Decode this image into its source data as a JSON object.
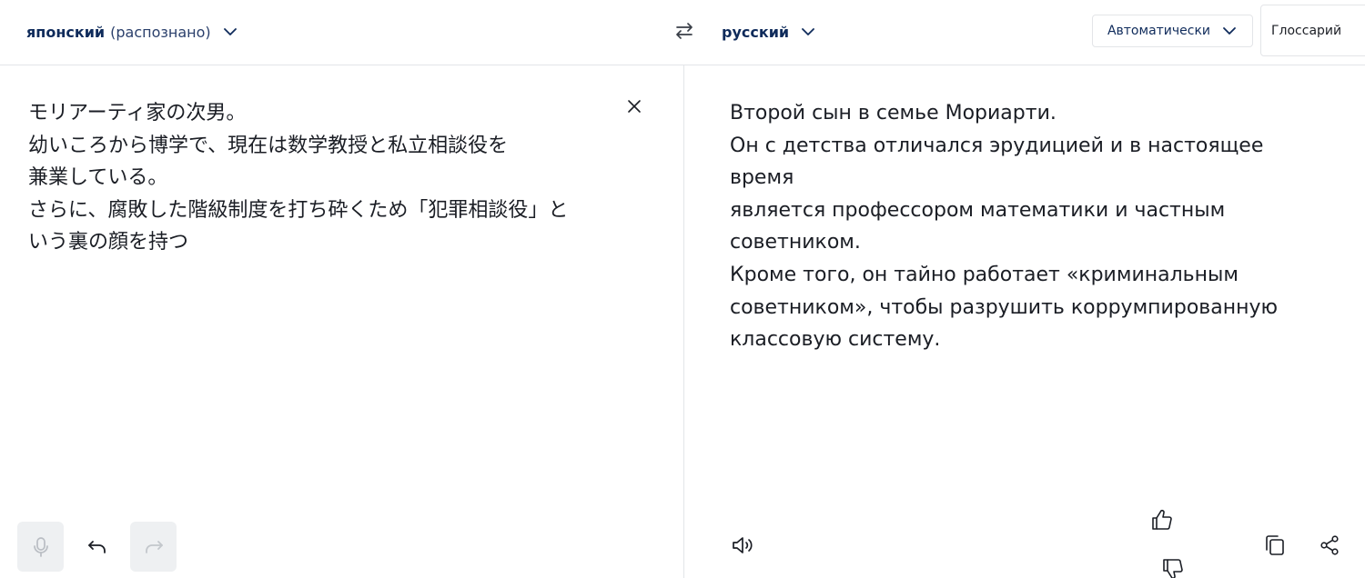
{
  "header": {
    "source_language": "японский",
    "source_detected": "(распознано)",
    "target_language": "русский",
    "formality_label": "Автоматически",
    "glossary_label": "Глоссарий"
  },
  "source": {
    "text": "モリアーティ家の次男。\n幼いころから博学で、現在は数学教授と私立相談役を\n兼業している。\nさらに、腐敗した階級制度を打ち砕くため「犯罪相談役」と\nいう裏の顔を持つ"
  },
  "target": {
    "text": "Второй сын в семье Мориарти.\nОн с детства отличался эрудицией и в настоящее время\nявляется профессором математики и частным\nсоветником.\nКроме того, он тайно работает «криминальным\nсоветником», чтобы разрушить коррумпированную\nклассовую систему."
  },
  "icons": {
    "source_toolbar": [
      "microphone-icon",
      "undo-icon",
      "redo-icon"
    ],
    "target_toolbar": [
      "speaker-icon",
      "thumbs-up-icon",
      "thumbs-down-icon",
      "copy-icon",
      "share-icon"
    ],
    "header": [
      "chevron-down-icon",
      "swap-icon"
    ],
    "clear": "close-icon"
  },
  "colors": {
    "accent": "#0f2b5b",
    "text": "#1b1e25",
    "border": "#e3e5e8",
    "disabled_bg": "#eef0f2"
  }
}
